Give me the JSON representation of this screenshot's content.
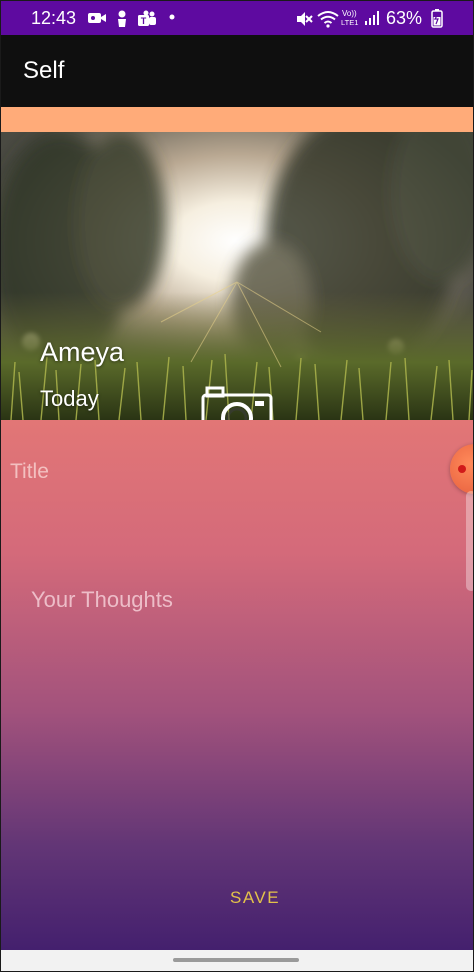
{
  "status_bar": {
    "time": "12:43",
    "battery_percent": "63%",
    "icons": [
      "video-icon",
      "lock-person-icon",
      "teams-icon",
      "notification-dot-icon",
      "mute-icon",
      "wifi-icon",
      "volte-icon",
      "signal-icon",
      "battery-icon"
    ],
    "volte_text": "Vo)) LTE1",
    "background_color": "#5e0aa0"
  },
  "app_bar": {
    "title": "Self",
    "background_color": "#0f0f0f"
  },
  "accent_color": "#ffab79",
  "header": {
    "author_name": "Ameya",
    "date": "Today",
    "camera_icon": "camera-icon"
  },
  "form": {
    "title_placeholder": "Title",
    "title_value": "",
    "thoughts_placeholder": "Your Thoughts",
    "thoughts_value": "",
    "save_label": "SAVE",
    "save_color": "#e3c24a"
  }
}
